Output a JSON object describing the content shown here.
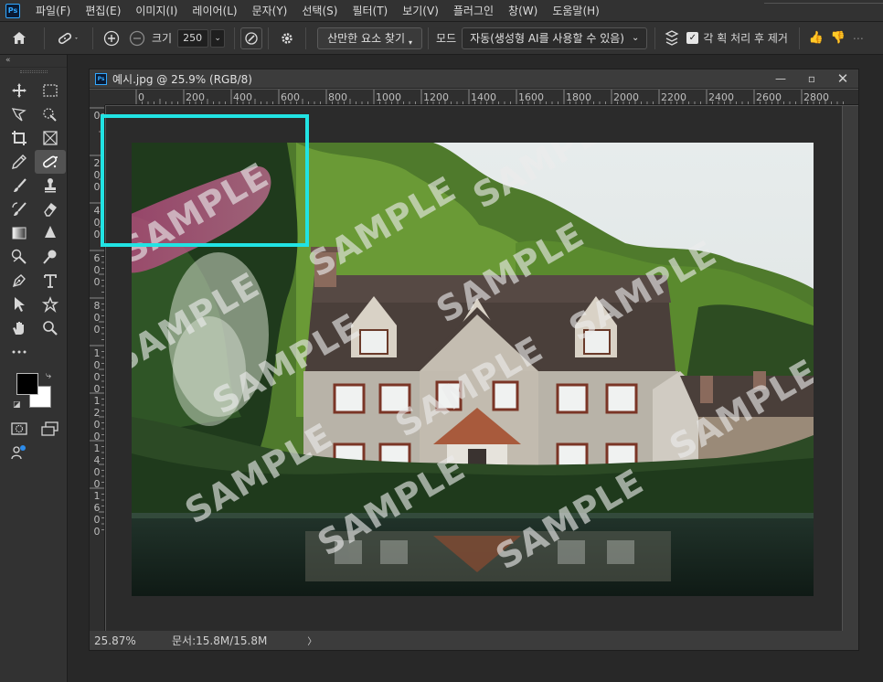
{
  "app": {
    "logo": "Ps"
  },
  "menu": [
    "파일(F)",
    "편집(E)",
    "이미지(I)",
    "레이어(L)",
    "문자(Y)",
    "선택(S)",
    "필터(T)",
    "보기(V)",
    "플러그인",
    "창(W)",
    "도움말(H)"
  ],
  "options": {
    "size_label": "크기",
    "size_value": "250",
    "find_button": "산만한 요소 찾기",
    "mode_label": "모드",
    "mode_value": "자동(생성형 AI를 사용할 수 있음)",
    "stroke_label": "각 획 처리 후 제거"
  },
  "toolbar": {
    "collapse": "«"
  },
  "document": {
    "title": "예시.jpg @ 25.9% (RGB/8)",
    "zoom": "25.87%",
    "doc_info": "문서:15.8M/15.8M",
    "arrow": "〉"
  },
  "ruler": {
    "h": [
      "0",
      "200",
      "400",
      "600",
      "800",
      "1000",
      "1200",
      "1400",
      "1600",
      "1800",
      "2000",
      "2200",
      "2400",
      "2600",
      "2800"
    ],
    "v": [
      "0",
      "200",
      "400",
      "600",
      "800",
      "1000",
      "1200",
      "1400",
      "1600"
    ]
  },
  "watermark": "SAMPLE",
  "colors": {
    "accent": "#31a8ff",
    "selection": "#21e3e3",
    "foreground": "#000000",
    "background": "#ffffff"
  }
}
